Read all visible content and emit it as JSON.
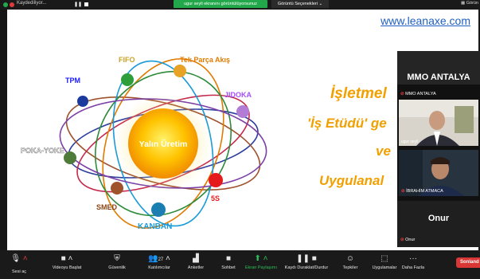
{
  "topbar": {
    "recording": "Kaydediliyor...",
    "green_notice": "ugur seyli ekranını görüntülüyorsunuz",
    "view_options": "Görüntü Seçenekleri ⌄",
    "right_label": "Görün"
  },
  "slide": {
    "url": "www.leanaxe.com",
    "center_label": "Yalın Üretim",
    "title_lines": [
      "İşletmel",
      "'İş Etüdü' ge",
      "ve",
      "Uygulanal"
    ],
    "nodes": [
      {
        "label": "FIFO",
        "color": "#c9a227"
      },
      {
        "label": "Tek Parça Akış",
        "color": "#e07b00"
      },
      {
        "label": "TPM",
        "color": "#1a1aff"
      },
      {
        "label": "JIDOKA",
        "color": "#a64dff"
      },
      {
        "label": "POKA-YOKE",
        "color": "#ffffff"
      },
      {
        "label": "SMED",
        "color": "#a0522d"
      },
      {
        "label": "5S",
        "color": "#e41a1c"
      },
      {
        "label": "KANBAN",
        "color": "#1a9ad6"
      }
    ]
  },
  "participants": {
    "header": "MMO ANTALYA",
    "tiles": [
      {
        "name": "MMO ANTALYA"
      },
      {
        "name": "ugur seyli"
      },
      {
        "name": "İBRAHİM ATMACA"
      },
      {
        "name": "Onur",
        "display": "Onur"
      }
    ]
  },
  "toolbar": {
    "items": [
      {
        "label": "Sesi aç",
        "icon": "mic-muted-icon"
      },
      {
        "label": "Videoyu Başlat",
        "icon": "video-off-icon"
      },
      {
        "label": "Güvenlik",
        "icon": "shield-icon"
      },
      {
        "label": "Katılımcılar",
        "icon": "participants-icon",
        "count": "27"
      },
      {
        "label": "Anketler",
        "icon": "chart-icon"
      },
      {
        "label": "Sohbet",
        "icon": "chat-icon"
      },
      {
        "label": "Ekran Paylaşımı",
        "icon": "share-screen-icon"
      },
      {
        "label": "Kaydı Duraklat/Durdur",
        "icon": "pause-stop-icon"
      },
      {
        "label": "Tepkiler",
        "icon": "smile-icon"
      },
      {
        "label": "Uygulamalar",
        "icon": "apps-icon"
      },
      {
        "label": "Daha Fazla",
        "icon": "more-icon"
      }
    ],
    "end_label": "Sonland"
  }
}
